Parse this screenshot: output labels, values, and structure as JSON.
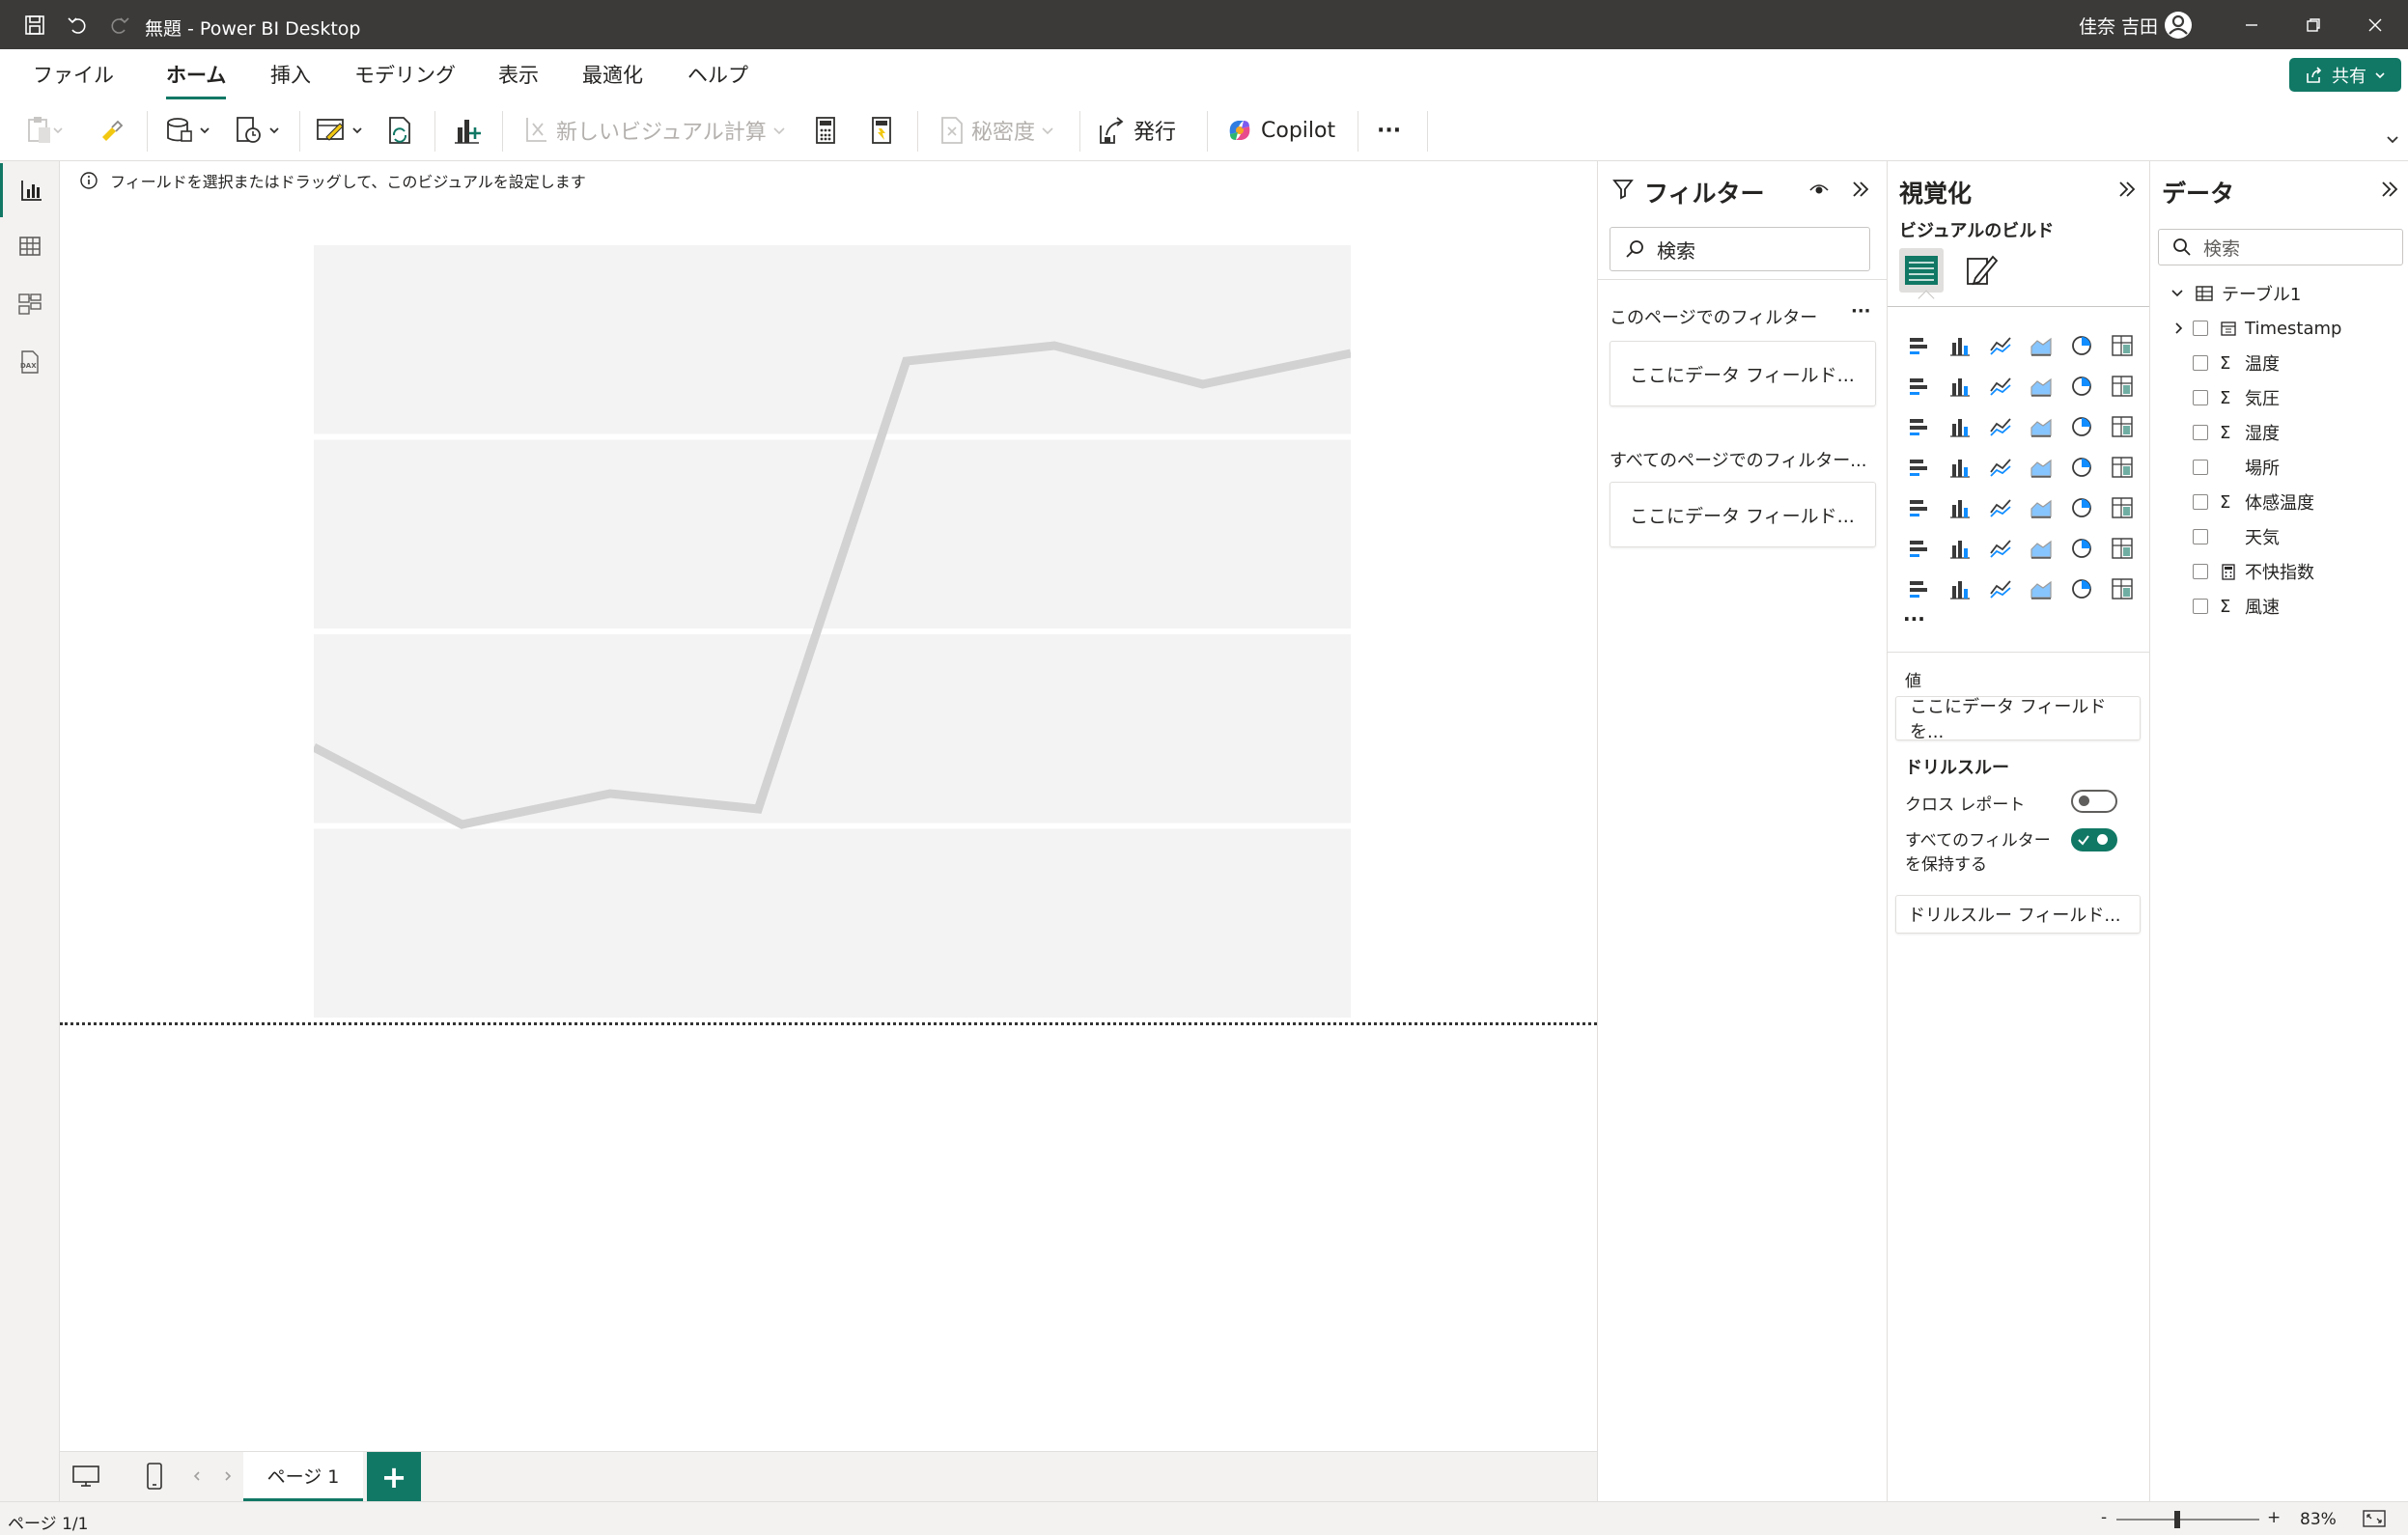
{
  "titlebar": {
    "title": "無題 - Power BI Desktop",
    "user": "佳奈 吉田"
  },
  "menu": {
    "items": [
      "ファイル",
      "ホーム",
      "挿入",
      "モデリング",
      "表示",
      "最適化",
      "ヘルプ"
    ],
    "active": "ホーム",
    "share_label": "共有"
  },
  "ribbon": {
    "new_visual_calc": "新しいビジュアル計算",
    "sensitivity": "秘密度",
    "publish": "発行",
    "copilot": "Copilot",
    "more": "···"
  },
  "canvas": {
    "hint": "フィールドを選択またはドラッグして、このビジュアルを設定します"
  },
  "chart_data": {
    "type": "line",
    "placeholder": true,
    "values": [
      0.35,
      0.25,
      0.29,
      0.27,
      0.85,
      0.87,
      0.82,
      0.86
    ],
    "ylim": [
      0,
      1
    ]
  },
  "filters": {
    "title": "フィルター",
    "search_placeholder": "検索",
    "this_page": "このページでのフィルター",
    "all_pages": "すべてのページでのフィルター...",
    "more": "···",
    "well_this_page": "ここにデータ フィールド...",
    "well_all_pages": "ここにデータ フィールド..."
  },
  "visualizations": {
    "title": "視覚化",
    "build_label": "ビジュアルのビルド",
    "more": "···",
    "values_label": "値",
    "values_well": "ここにデータ フィールドを...",
    "drillthrough_title": "ドリルスルー",
    "cross_report": "クロス レポート",
    "keep_filters": "すべてのフィルター\nを保持する",
    "keep_filters_1": "すべてのフィルター",
    "keep_filters_2": "を保持する",
    "drill_well": "ドリルスルー フィールド...",
    "cross_report_on": false,
    "keep_filters_on": true
  },
  "data_pane": {
    "title": "データ",
    "search_placeholder": "検索",
    "table_name": "テーブル1",
    "fields": [
      {
        "name": "Timestamp",
        "type": "calendar",
        "expandable": true
      },
      {
        "name": "温度",
        "type": "sigma"
      },
      {
        "name": "気圧",
        "type": "sigma"
      },
      {
        "name": "湿度",
        "type": "sigma"
      },
      {
        "name": "場所",
        "type": "none"
      },
      {
        "name": "体感温度",
        "type": "sigma"
      },
      {
        "name": "天気",
        "type": "none"
      },
      {
        "name": "不快指数",
        "type": "calc"
      },
      {
        "name": "風速",
        "type": "sigma"
      }
    ]
  },
  "pages": {
    "tab_label": "ページ 1",
    "add_label": "+"
  },
  "status": {
    "page_indicator": "ページ 1/1",
    "zoom_minus": "-",
    "zoom_plus": "+",
    "zoom": "83%"
  },
  "colors": {
    "accent": "#117865",
    "titlebar": "#3b3a39",
    "placeholder_line": "#d2d2d2",
    "placeholder_band": "#f3f3f3"
  }
}
